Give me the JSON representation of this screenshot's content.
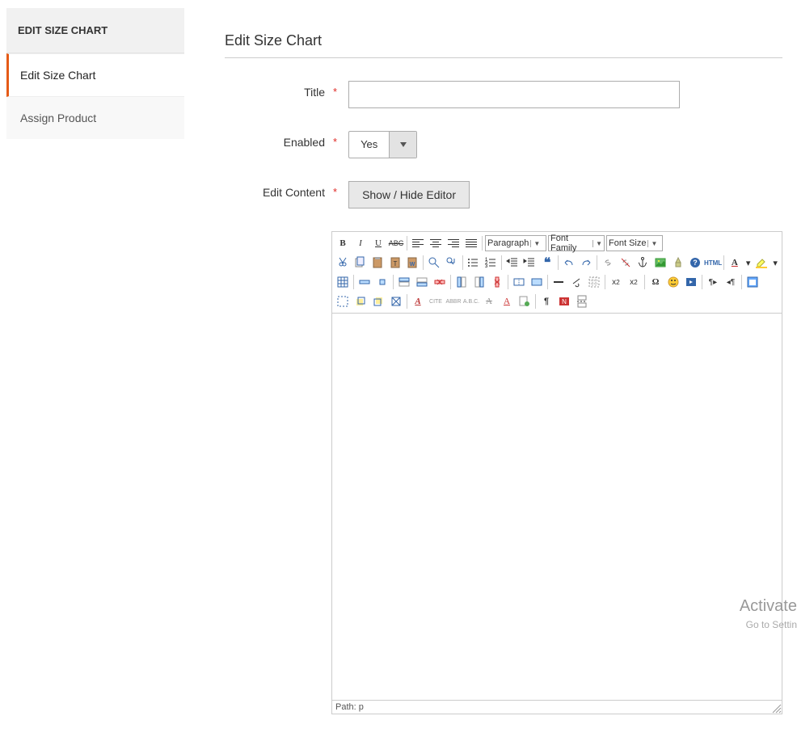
{
  "sidebar": {
    "title": "EDIT SIZE CHART",
    "tabs": [
      {
        "label": "Edit Size Chart",
        "active": true
      },
      {
        "label": "Assign Product",
        "active": false
      }
    ]
  },
  "main": {
    "title": "Edit Size Chart",
    "fields": {
      "title": {
        "label": "Title",
        "value": ""
      },
      "enabled": {
        "label": "Enabled",
        "value": "Yes"
      },
      "edit_content": {
        "label": "Edit Content",
        "toggle_button": "Show / Hide Editor"
      }
    }
  },
  "editor": {
    "dropdowns": {
      "paragraph": "Paragraph",
      "font_family": "Font Family",
      "font_size": "Font Size"
    },
    "path_label": "Path:",
    "path_value": "p",
    "content": ""
  },
  "watermark": {
    "line1": "Activate",
    "line2": "Go to Settin"
  }
}
